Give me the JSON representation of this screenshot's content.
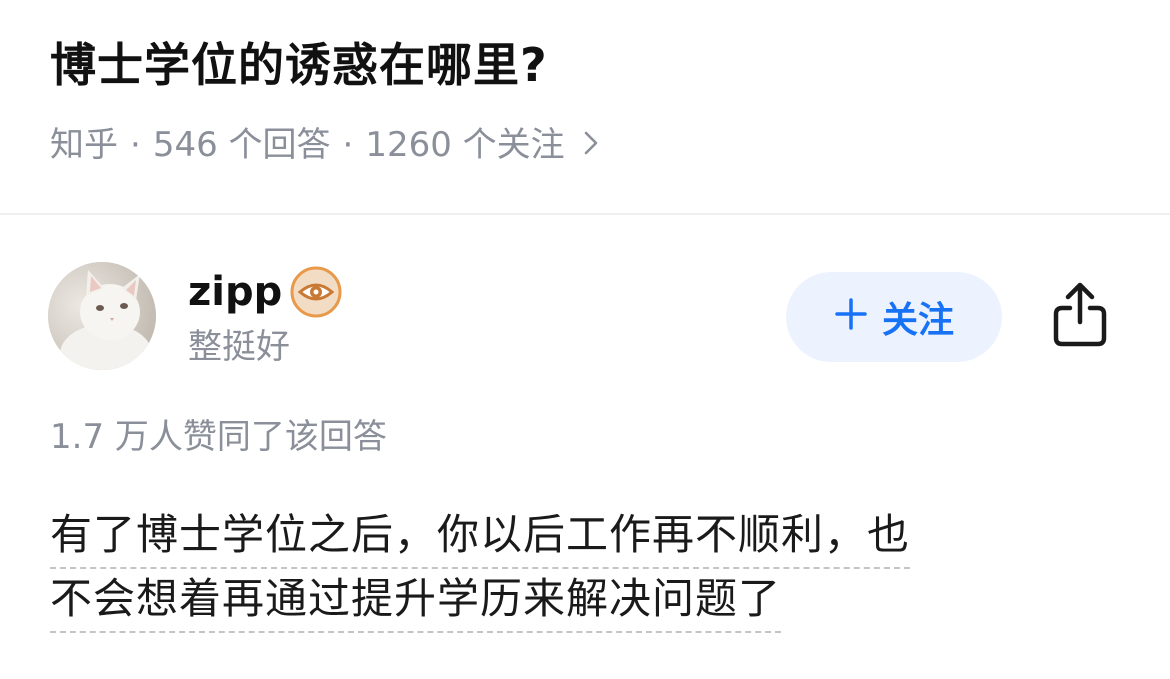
{
  "question": {
    "title": "博士学位的诱惑在哪里?",
    "source": "知乎",
    "separator": "·",
    "answers_count": "546 个回答",
    "followers_count": "1260 个关注",
    "chevron_icon": "chevron-right-icon"
  },
  "author": {
    "name": "zipp",
    "badge_icon": "eye-badge-icon",
    "bio": "整挺好",
    "avatar": "cat-avatar"
  },
  "actions": {
    "follow_label": "关注",
    "follow_icon": "plus-icon",
    "share_icon": "share-icon"
  },
  "answer": {
    "votes_text": "1.7 万人赞同了该回答",
    "lines": [
      "有了博士学位之后，你以后工作再不顺利，也",
      "不会想着再通过提升学历来解决问题了"
    ]
  },
  "colors": {
    "accent": "#1772f6",
    "follow_bg": "#edf3fe",
    "meta_gray": "#8a8f99",
    "badge_orange": "#e89a4a"
  }
}
